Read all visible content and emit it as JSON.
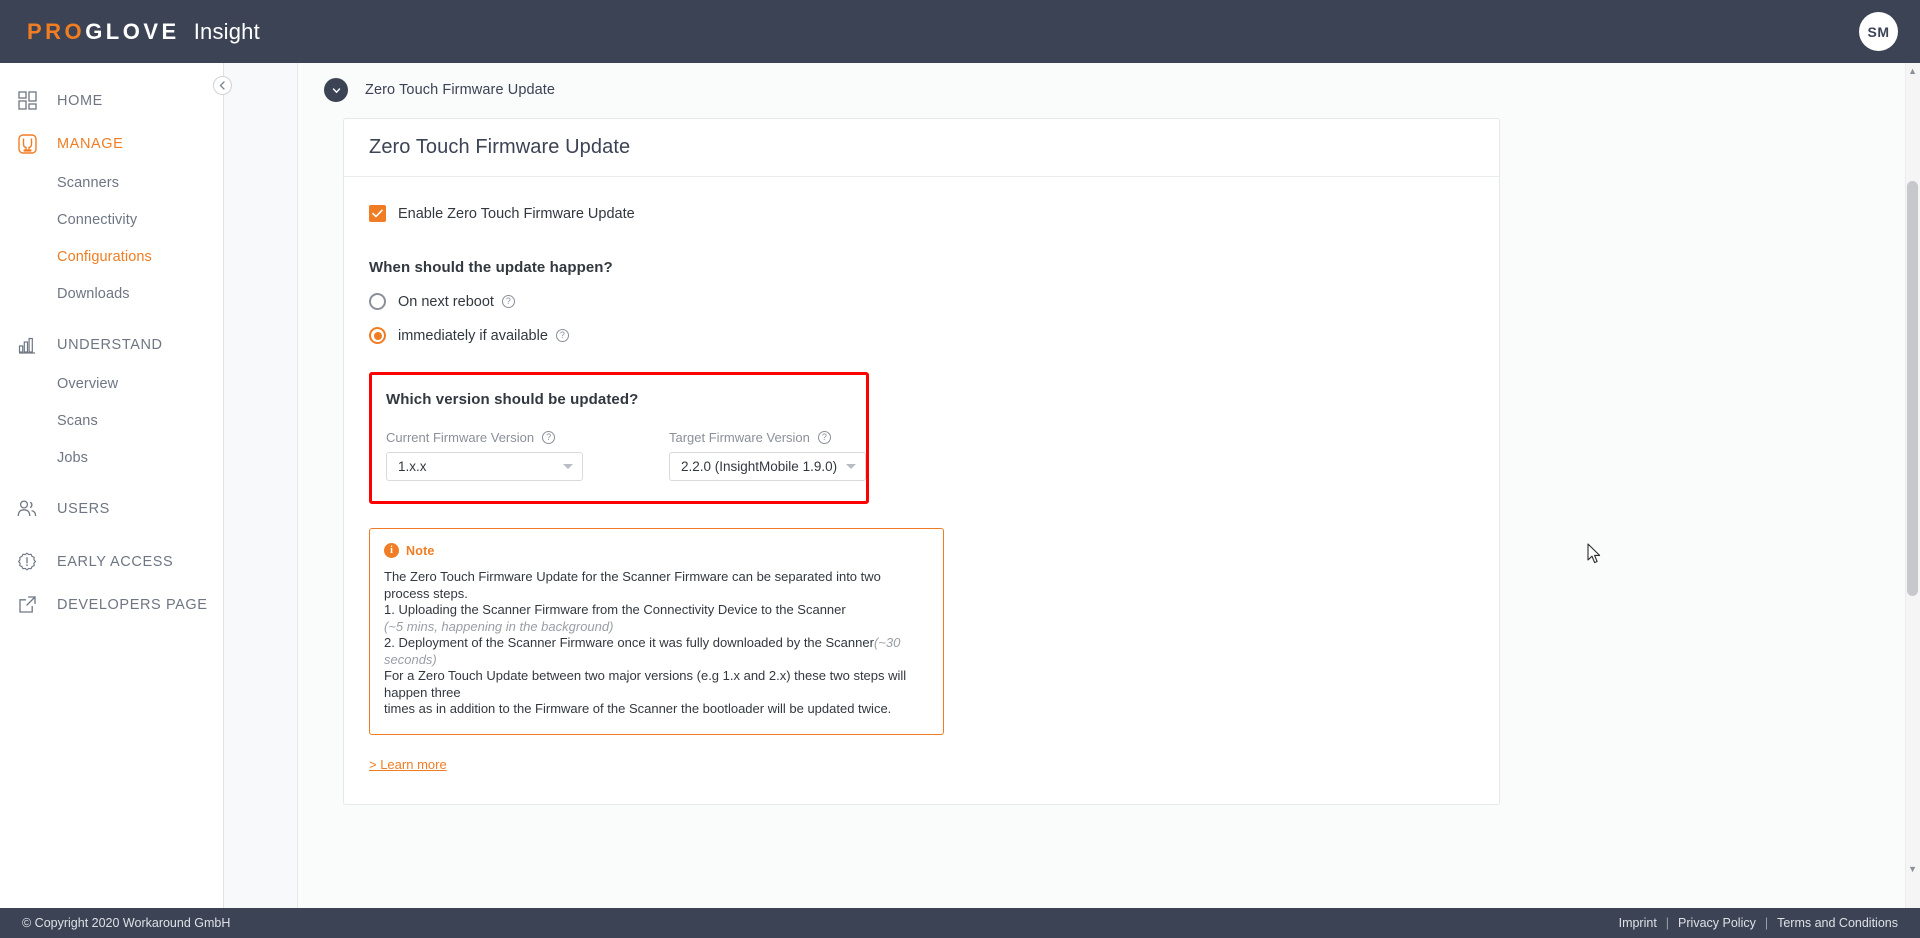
{
  "header": {
    "logo_pro": "PRO",
    "logo_glove": "GLOVE",
    "product": "Insight",
    "avatar_initials": "SM"
  },
  "sidebar": {
    "collapse_icon": "chevron-left-icon",
    "items": [
      {
        "label": "HOME",
        "icon": "dashboard-grid-icon",
        "active": false
      },
      {
        "label": "MANAGE",
        "icon": "glove-icon",
        "active": true
      },
      {
        "label": "UNDERSTAND",
        "icon": "bar-chart-icon",
        "active": false
      },
      {
        "label": "USERS",
        "icon": "people-icon",
        "active": false
      },
      {
        "label": "EARLY ACCESS",
        "icon": "badge-alert-icon",
        "active": false
      },
      {
        "label": "DEVELOPERS PAGE",
        "icon": "external-link-icon",
        "active": false
      }
    ],
    "manage_sub": [
      {
        "label": "Scanners",
        "active": false
      },
      {
        "label": "Connectivity",
        "active": false
      },
      {
        "label": "Configurations",
        "active": true
      },
      {
        "label": "Downloads",
        "active": false
      }
    ],
    "understand_sub": [
      {
        "label": "Overview",
        "active": false
      },
      {
        "label": "Scans",
        "active": false
      },
      {
        "label": "Jobs",
        "active": false
      }
    ]
  },
  "main": {
    "section_title": "Zero Touch Firmware Update",
    "card_title": "Zero Touch Firmware Update",
    "enable_checkbox": {
      "label": "Enable Zero Touch Firmware Update",
      "checked": true
    },
    "schedule": {
      "question": "When should the update happen?",
      "options": [
        {
          "label": "On next reboot",
          "selected": false,
          "help": "?"
        },
        {
          "label": "immediately if available",
          "selected": true,
          "help": "?"
        }
      ]
    },
    "version": {
      "question": "Which version should be updated?",
      "highlight_color": "#ff0000",
      "current": {
        "label": "Current Firmware Version",
        "value": "1.x.x",
        "help": "?"
      },
      "target": {
        "label": "Target Firmware Version",
        "value": "2.2.0 (InsightMobile 1.9.0)",
        "help": "?"
      }
    },
    "note": {
      "icon": "info-icon",
      "title": "Note",
      "lines": [
        {
          "text": "The Zero Touch Firmware Update for the Scanner Firmware can be separated into two process steps.",
          "muted": false
        },
        {
          "text": "1. Uploading the Scanner Firmware from the Connectivity Device to the Scanner",
          "muted": false
        },
        {
          "text": "(~5 mins, happening in the background)",
          "muted": true
        },
        {
          "text": "2. Deployment of the Scanner Firmware once it was fully downloaded by the Scanner",
          "suffix": "(~30 seconds)",
          "muted": false
        },
        {
          "text": "For a Zero Touch Update between two major versions (e.g 1.x and 2.x) these two steps will happen three",
          "muted": false
        },
        {
          "text": "times as in addition to the Firmware of the Scanner the bootloader will be updated twice.",
          "muted": false
        }
      ]
    },
    "learn_more": "> Learn more"
  },
  "footer": {
    "copyright": "© Copyright 2020 Workaround GmbH",
    "links": [
      "Imprint",
      "Privacy Policy",
      "Terms and Conditions"
    ],
    "separator": "|"
  },
  "colors": {
    "brand_orange": "#f07d23",
    "dark_slate": "#3b4354",
    "highlight_red": "#ff0000"
  }
}
